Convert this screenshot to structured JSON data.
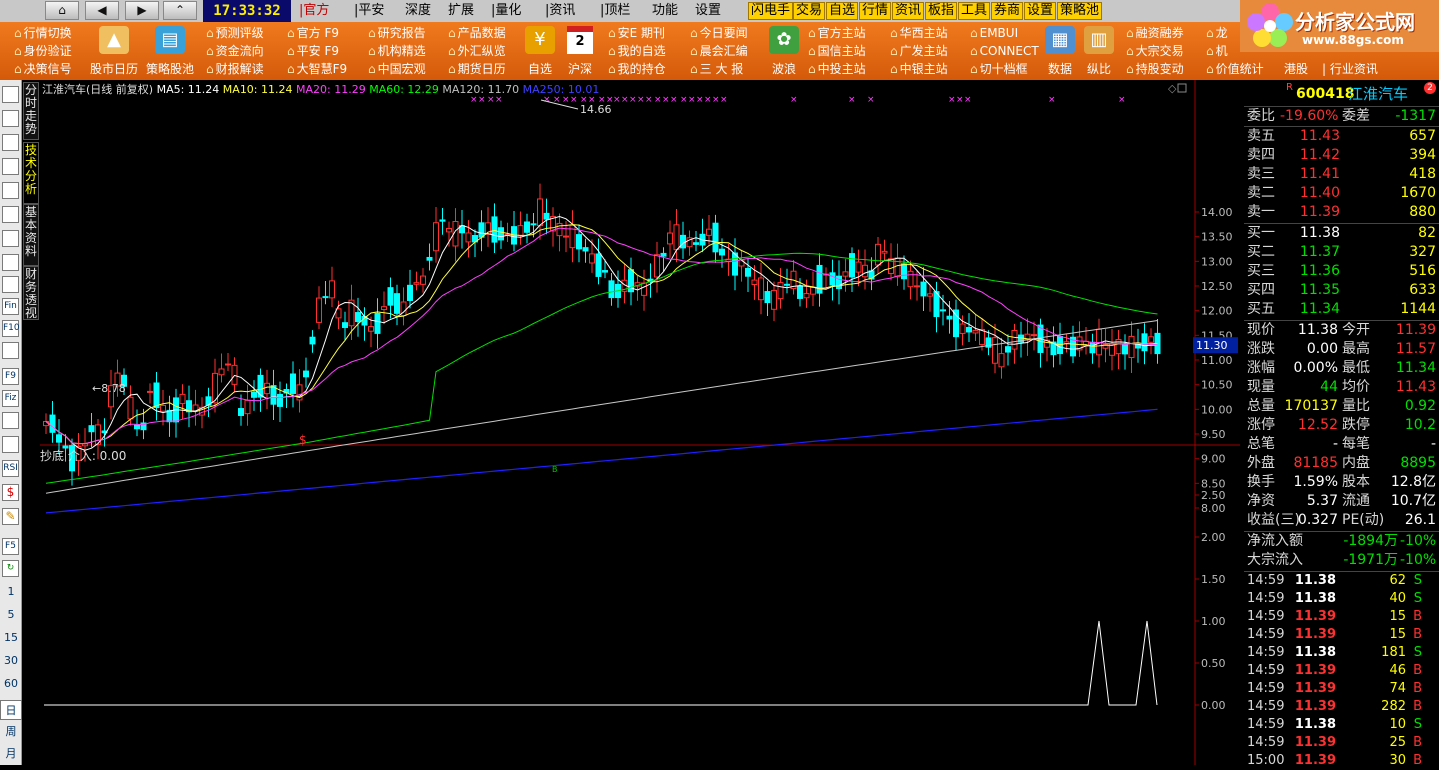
{
  "topbar": {
    "nav": [
      "⌂",
      "◀",
      "▶",
      "⌃"
    ],
    "time": "17:33:32",
    "menu": [
      "|官方",
      "|平安",
      "深度",
      "扩展",
      "|量化",
      "|资讯",
      "|顶栏",
      "功能",
      "设置"
    ],
    "highlights": [
      "闪电手",
      "交易",
      "自选",
      "行情",
      "资讯",
      "板指",
      "工具",
      "券商",
      "设置",
      "策略池"
    ],
    "logo": "分析家公式网",
    "logo_url": "www.88gs.com"
  },
  "ribbon": {
    "col1": [
      "行情切换",
      "身份验证",
      "决策信号"
    ],
    "b1": "股市日历",
    "b2": "策略股池",
    "col2": [
      "预测评级",
      "资金流向",
      "财报解读"
    ],
    "col3": [
      "官方  F9",
      "平安  F9",
      "大智慧F9"
    ],
    "col4": [
      "研究报告",
      "机构精选",
      "中国宏观"
    ],
    "col5": [
      "产品数据",
      "外汇纵览",
      "期货日历"
    ],
    "b3": "自选",
    "b4": "沪深",
    "col6": [
      "安E 期刊",
      "我的自选",
      "我的持仓"
    ],
    "col7": [
      "今日要闻",
      "晨会汇编",
      "三 大 报"
    ],
    "b5": "波浪",
    "col8": [
      "官方主站",
      "国信主站",
      "中投主站"
    ],
    "col9": [
      "华西主站",
      "广发主站",
      "中银主站"
    ],
    "col10": [
      "EMBUI",
      "CONNECT",
      "切十档框"
    ],
    "b6": "数据",
    "b7": "纵比",
    "col11": [
      "融资融券",
      "大宗交易",
      "持股变动"
    ],
    "col12": [
      "龙",
      "机",
      "价值统计"
    ],
    "extra": [
      "港股",
      "行业资讯"
    ],
    "cal_day": "2"
  },
  "leftbar": {
    "tools": [
      "Fin",
      "F10",
      "F9",
      "Fiz",
      "RSI",
      "$"
    ],
    "periods": [
      "1",
      "5",
      "15",
      "30",
      "60"
    ],
    "dwm": [
      "日",
      "周",
      "月"
    ]
  },
  "vtabs": [
    "分时走势",
    "技术分析",
    "基本资料",
    "财务透视"
  ],
  "chart_header": {
    "title": "江淮汽车(日线 前复权)",
    "ma": [
      {
        "label": "MA5: 11.24",
        "color": "#ffffff"
      },
      {
        "label": "MA10: 11.24",
        "color": "#ffff40"
      },
      {
        "label": "MA20: 11.29",
        "color": "#ff40ff"
      },
      {
        "label": "MA60: 12.29",
        "color": "#00ff00"
      },
      {
        "label": "MA120: 11.70",
        "color": "#c0c0c0"
      },
      {
        "label": "MA250: 10.01",
        "color": "#4040ff"
      }
    ],
    "high_label": "14.66",
    "low_label": "8.78",
    "current_tag": "11.30",
    "yticks": [
      "14.00",
      "13.50",
      "13.00",
      "12.50",
      "12.00",
      "11.50",
      "11.00",
      "10.50",
      "10.00",
      "9.50",
      "9.00",
      "8.50",
      "8.00"
    ]
  },
  "indicator": {
    "title": "抄底  介入: 0.00",
    "yticks": [
      "2.50",
      "2.00",
      "1.50",
      "1.00",
      "0.50",
      "0.00"
    ],
    "tag": "B"
  },
  "quote": {
    "code": "600418",
    "name": "江淮汽车",
    "weibi_label": "委比",
    "weibi": "-19.60%",
    "weicha_label": "委差",
    "weicha": "-1317",
    "asks": [
      [
        "卖五",
        "11.43",
        "657"
      ],
      [
        "卖四",
        "11.42",
        "394"
      ],
      [
        "卖三",
        "11.41",
        "418"
      ],
      [
        "卖二",
        "11.40",
        "1670"
      ],
      [
        "卖一",
        "11.39",
        "880"
      ]
    ],
    "bids": [
      [
        "买一",
        "11.38",
        "82"
      ],
      [
        "买二",
        "11.37",
        "327"
      ],
      [
        "买三",
        "11.36",
        "516"
      ],
      [
        "买四",
        "11.35",
        "633"
      ],
      [
        "买五",
        "11.34",
        "1144"
      ]
    ],
    "stats": [
      [
        "现价",
        "11.38",
        "今开",
        "11.39"
      ],
      [
        "涨跌",
        "0.00",
        "最高",
        "11.57"
      ],
      [
        "涨幅",
        "0.00%",
        "最低",
        "11.34"
      ],
      [
        "现量",
        "44",
        "均价",
        "11.43"
      ],
      [
        "总量",
        "170137",
        "量比",
        "0.92"
      ],
      [
        "涨停",
        "12.52",
        "跌停",
        "10.2"
      ],
      [
        "总笔",
        "-",
        "每笔",
        "-"
      ],
      [
        "外盘",
        "81185",
        "内盘",
        "8895"
      ],
      [
        "换手",
        "1.59%",
        "股本",
        "12.8亿"
      ],
      [
        "净资",
        "5.37",
        "流通",
        "10.7亿"
      ],
      [
        "收益(三)",
        "0.327",
        "PE(动)",
        "26.1"
      ]
    ],
    "flow": [
      [
        "净流入额",
        "-1894万",
        "-10%"
      ],
      [
        "大宗流入",
        "-1971万",
        "-10%"
      ]
    ],
    "ticks": [
      [
        "14:59",
        "11.38",
        "62",
        "S"
      ],
      [
        "14:59",
        "11.38",
        "40",
        "S"
      ],
      [
        "14:59",
        "11.39",
        "15",
        "B"
      ],
      [
        "14:59",
        "11.39",
        "15",
        "B"
      ],
      [
        "14:59",
        "11.38",
        "181",
        "S"
      ],
      [
        "14:59",
        "11.39",
        "46",
        "B"
      ],
      [
        "14:59",
        "11.39",
        "74",
        "B"
      ],
      [
        "14:59",
        "11.39",
        "282",
        "B"
      ],
      [
        "14:59",
        "11.38",
        "10",
        "S"
      ],
      [
        "14:59",
        "11.39",
        "25",
        "B"
      ],
      [
        "15:00",
        "11.39",
        "30",
        "B"
      ]
    ]
  },
  "colors": {
    "up": "#ff3030",
    "down": "#00ffff",
    "axis": "#a00000"
  }
}
